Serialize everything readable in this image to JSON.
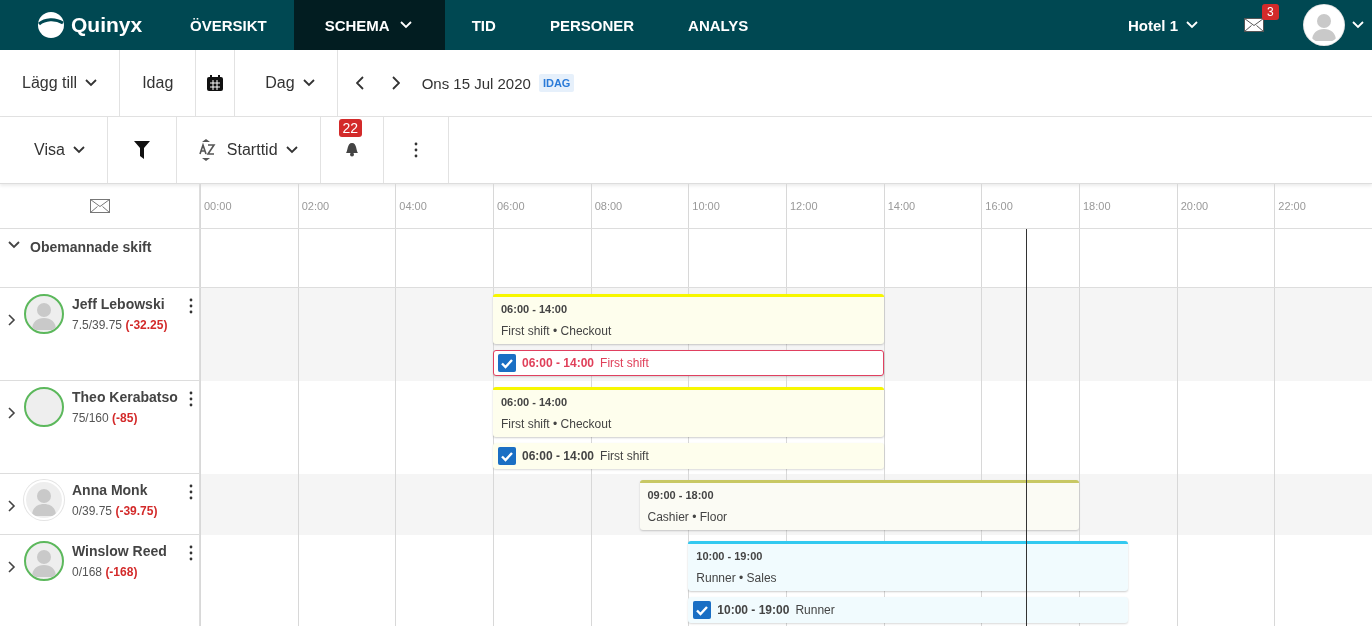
{
  "nav": {
    "logo": "Quinyx",
    "items": [
      {
        "label": "ÖVERSIKT",
        "selected": false,
        "dropdown": false
      },
      {
        "label": "SCHEMA",
        "selected": true,
        "dropdown": true
      },
      {
        "label": "TID",
        "selected": false,
        "dropdown": false
      },
      {
        "label": "PERSONER",
        "selected": false,
        "dropdown": false
      },
      {
        "label": "ANALYS",
        "selected": false,
        "dropdown": false
      }
    ],
    "unit": "Hotel 1",
    "mail_badge": "3"
  },
  "toolbar": {
    "add": "Lägg till",
    "today": "Idag",
    "view": "Dag",
    "date": "Ons 15 Jul 2020",
    "today_badge": "IDAG",
    "show": "Visa",
    "sort": "Starttid",
    "alerts_badge": "22"
  },
  "timeline": {
    "hours": [
      "00:00",
      "02:00",
      "04:00",
      "06:00",
      "08:00",
      "10:00",
      "12:00",
      "14:00",
      "16:00",
      "18:00",
      "20:00",
      "22:00"
    ],
    "now_line": {
      "level": 0.705
    }
  },
  "unmanned": {
    "label": "Obemannade skift",
    "expanded": true
  },
  "employees": [
    {
      "name": "Jeff Lebowski",
      "hours": "7.5/39.75",
      "diff": "(-32.25)",
      "has_photo": true,
      "ring": true,
      "shifts": [
        {
          "time": "06:00 - 14:00",
          "detail": "First shift • Checkout",
          "color": "#f7f700"
        }
      ],
      "punches": [
        {
          "time": "06:00 - 14:00",
          "label": "First shift",
          "checked": true,
          "error": true
        }
      ]
    },
    {
      "name": "Theo Kerabatso",
      "hours": "75/160",
      "diff": "(-85)",
      "has_photo": false,
      "ring": true,
      "shifts": [
        {
          "time": "06:00 - 14:00",
          "detail": "First shift • Checkout",
          "color": "#f7f700"
        }
      ],
      "punches": [
        {
          "time": "06:00 - 14:00",
          "label": "First shift",
          "checked": true,
          "error": false
        }
      ]
    },
    {
      "name": "Anna Monk",
      "hours": "0/39.75",
      "diff": "(-39.75)",
      "has_photo": true,
      "ring": false,
      "shifts": [
        {
          "time": "09:00 - 18:00",
          "detail": "Cashier • Floor",
          "color": "#c8c864"
        }
      ]
    },
    {
      "name": "Winslow Reed",
      "hours": "0/168",
      "diff": "(-168)",
      "has_photo": true,
      "ring": true,
      "shifts": [
        {
          "time": "10:00 - 19:00",
          "detail": "Runner • Sales",
          "color": "#33c9f0"
        }
      ],
      "punches": [
        {
          "time": "10:00 - 19:00",
          "label": "Runner",
          "checked": true,
          "error": false
        }
      ]
    }
  ]
}
